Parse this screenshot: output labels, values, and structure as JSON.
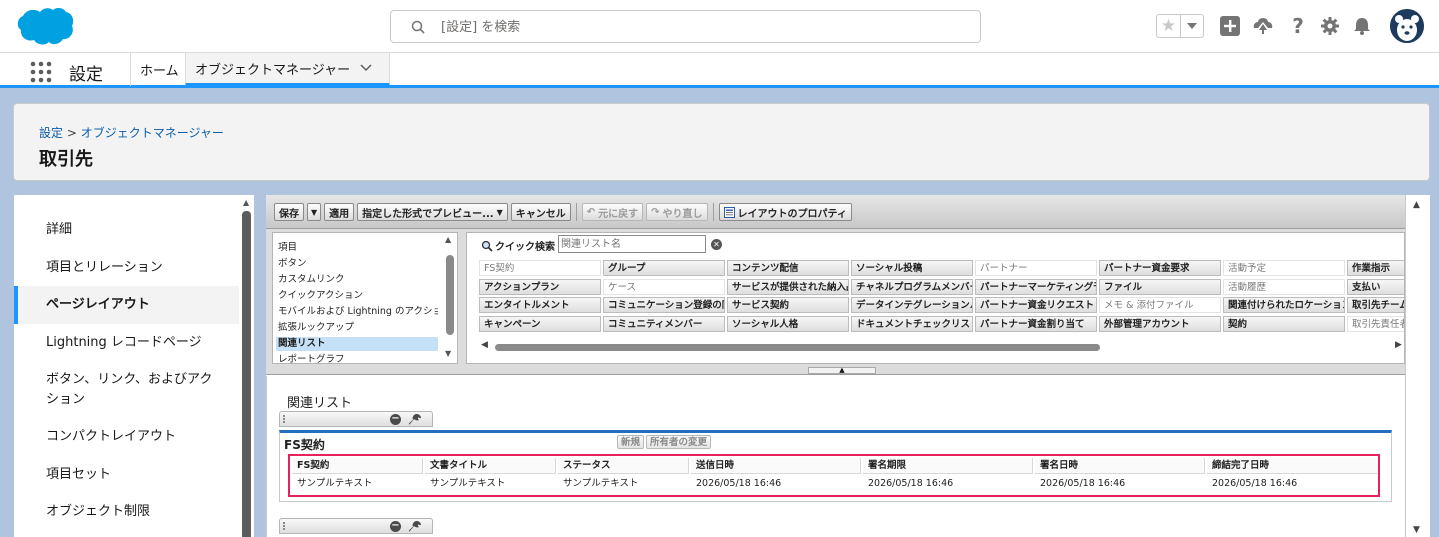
{
  "header": {
    "search_placeholder": "[設定] を検索",
    "icons": [
      "favorites-star-icon",
      "favorites-dropdown-icon",
      "global-create-icon",
      "trailhead-icon",
      "help-icon",
      "setup-gear-icon",
      "notifications-bell-icon",
      "avatar"
    ]
  },
  "nav": {
    "app_name": "設定",
    "tabs": [
      {
        "label": "ホーム"
      },
      {
        "label": "オブジェクトマネージャー"
      }
    ]
  },
  "page": {
    "breadcrumb": {
      "setup": "設定",
      "sep": ">",
      "object_manager": "オブジェクトマネージャー"
    },
    "title": "取引先"
  },
  "sidebar": {
    "items": [
      {
        "label": "詳細"
      },
      {
        "label": "項目とリレーション"
      },
      {
        "label": "ページレイアウト",
        "active": true
      },
      {
        "label": "Lightning レコードページ"
      },
      {
        "label": "ボタン、リンク、およびアク"
      },
      {
        "label": "ション"
      },
      {
        "label": "コンパクトレイアウト"
      },
      {
        "label": "項目セット"
      },
      {
        "label": "オブジェクト制限"
      }
    ]
  },
  "toolbar": {
    "save": "保存",
    "apply": "適用",
    "preview": "指定した形式でプレビュー...",
    "cancel": "キャンセル",
    "undo": "元に戻す",
    "redo": "やり直し",
    "properties": "レイアウトのプロパティ"
  },
  "palette": {
    "categories": [
      "項目",
      "ボタン",
      "カスタムリンク",
      "クイックアクション",
      "モバイルおよび Lightning のアクション",
      "拡張ルックアップ",
      "関連リスト",
      "レポートグラフ"
    ],
    "selected_category": "関連リスト",
    "quick_find_label": "クイック検索",
    "quick_find_placeholder": "関連リスト名",
    "items": [
      [
        "FS契約",
        "アクションプラン",
        "エンタイトルメント",
        "キャンペーン"
      ],
      [
        "グループ",
        "ケース",
        "コミュニケーション登録の同意",
        "コミュニティメンバー"
      ],
      [
        "コンテンツ配信",
        "サービスが提供された納入品",
        "サービス契約",
        "ソーシャル人格"
      ],
      [
        "ソーシャル投稿",
        "チャネルプログラムメンバー",
        "データインテグレーションルール",
        "ドキュメントチェックリスト項目"
      ],
      [
        "パートナー",
        "パートナーマーケティング予算",
        "パートナー資金リクエスト",
        "パートナー資金割り当て"
      ],
      [
        "パートナー資金要求",
        "ファイル",
        "メモ & 添付ファイル",
        "外部管理アカウント"
      ],
      [
        "活動予定",
        "活動履歴",
        "関連付けられたロケーション",
        "契約"
      ],
      [
        "作業指示",
        "支払い",
        "取引先チーム",
        "取引先責任者"
      ]
    ],
    "used": [
      "FS契約",
      "ケース",
      "パートナー",
      "活動予定",
      "活動履歴",
      "メモ & 添付ファイル",
      "取引先責任者"
    ]
  },
  "canvas": {
    "section_title": "関連リスト",
    "related_list": {
      "name": "FS契約",
      "buttons": [
        "新規",
        "所有者の変更"
      ],
      "columns": [
        "FS契約",
        "文書タイトル",
        "ステータス",
        "送信日時",
        "署名期限",
        "署名日時",
        "締結完了日時"
      ],
      "row": [
        "サンプルテキスト",
        "サンプルテキスト",
        "サンプルテキスト",
        "2026/05/18 16:46",
        "2026/05/18 16:46",
        "2026/05/18 16:46",
        "2026/05/18 16:46"
      ]
    }
  },
  "colors": {
    "brand": "#00a1e0",
    "accent": "#1b96ff",
    "highlight_border": "#e8205b",
    "link": "#0b5cab"
  }
}
